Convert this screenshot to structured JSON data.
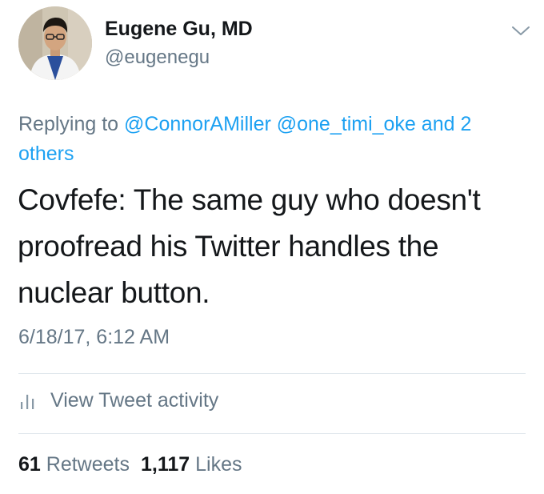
{
  "author": {
    "name": "Eugene Gu, MD",
    "handle": "@eugenegu"
  },
  "reply": {
    "prefix": "Replying to",
    "mention_1": "@ConnorAMiller",
    "mention_2": "@one_timi_oke",
    "others": "and 2 others"
  },
  "tweet": {
    "text": "Covfefe: The same guy who doesn't proofread his Twitter handles the nuclear button.",
    "timestamp": "6/18/17, 6:12 AM"
  },
  "activity": {
    "label": "View Tweet activity",
    "icon": "bar-chart-icon"
  },
  "stats": {
    "retweets_count": "61",
    "retweets_label": "Retweets",
    "likes_count": "1,117",
    "likes_label": "Likes"
  },
  "colors": {
    "link": "#1da1f2",
    "secondary_text": "#657786",
    "primary_text": "#14171a",
    "divider": "#e1e8ed"
  }
}
